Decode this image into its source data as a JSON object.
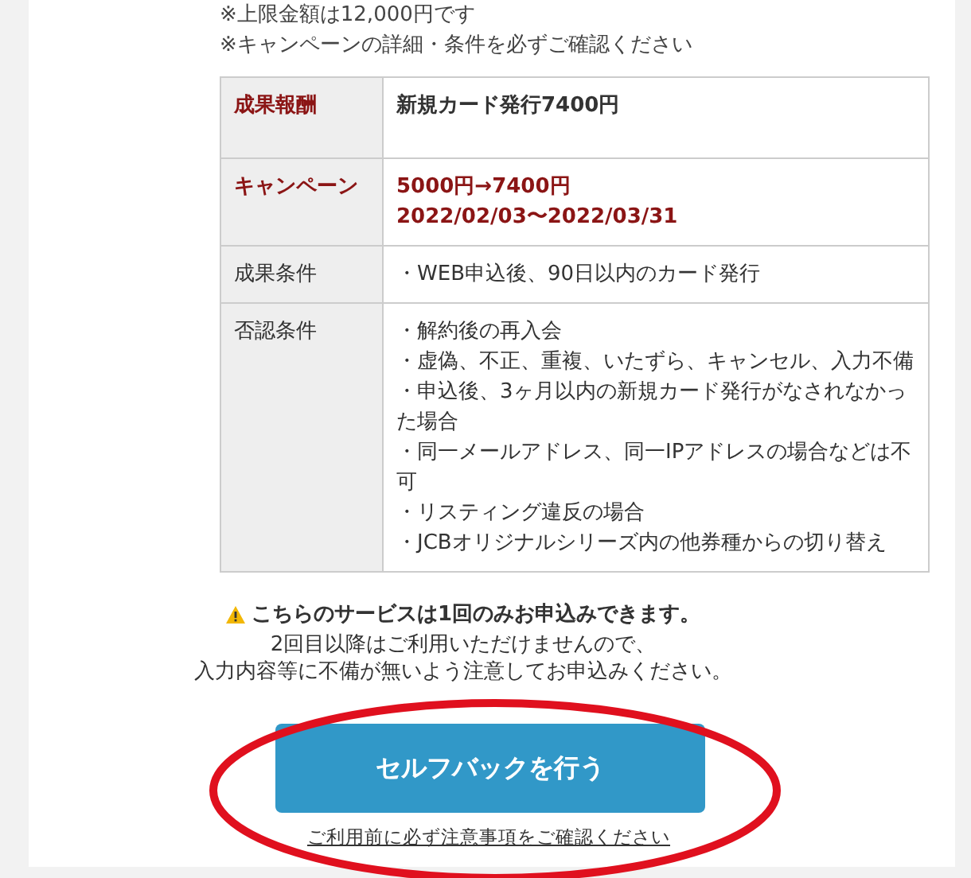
{
  "notes": [
    "※上限金額は12,000円です",
    "※キャンペーンの詳細・条件を必ずご確認ください"
  ],
  "table": {
    "rows": [
      {
        "label": "成果報酬",
        "kind": "emphasis",
        "lines": [
          "新規カード発行7400円"
        ]
      },
      {
        "label": "キャンペーン",
        "kind": "campaign",
        "lines": [
          "5000円→7400円",
          "2022/02/03〜2022/03/31"
        ]
      },
      {
        "label": "成果条件",
        "kind": "plain",
        "lines": [
          "・WEB申込後、90日以内のカード発行"
        ]
      },
      {
        "label": "否認条件",
        "kind": "plain",
        "lines": [
          "・解約後の再入会",
          "・虚偽、不正、重複、いたずら、キャンセル、入力不備",
          "・申込後、3ヶ月以内の新規カード発行がなされなかった場合",
          "・同一メールアドレス、同一IPアドレスの場合などは不可",
          "・リスティング違反の場合",
          "・JCBオリジナルシリーズ内の他券種からの切り替え"
        ]
      }
    ]
  },
  "warning": {
    "title": "こちらのサービスは1回のみお申込みできます。",
    "lines": [
      "2回目以降はご利用いただけませんので、",
      "入力内容等に不備が無いよう注意してお申込みください。"
    ]
  },
  "button": {
    "label": "セルフバックを行う"
  },
  "link": {
    "label": "ご利用前に必ず注意事項をご確認ください"
  },
  "annotation": {
    "kind": "ellipse",
    "color": "#e0101e"
  }
}
